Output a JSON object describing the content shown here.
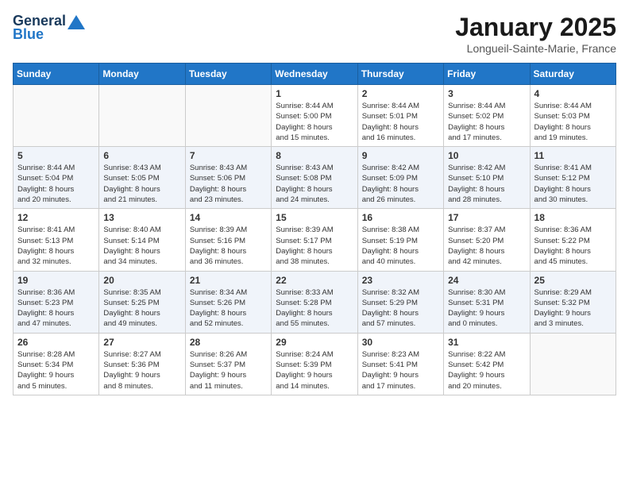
{
  "header": {
    "logo_general": "General",
    "logo_blue": "Blue",
    "month": "January 2025",
    "location": "Longueil-Sainte-Marie, France"
  },
  "days_of_week": [
    "Sunday",
    "Monday",
    "Tuesday",
    "Wednesday",
    "Thursday",
    "Friday",
    "Saturday"
  ],
  "weeks": [
    [
      {
        "day": "",
        "info": ""
      },
      {
        "day": "",
        "info": ""
      },
      {
        "day": "",
        "info": ""
      },
      {
        "day": "1",
        "info": "Sunrise: 8:44 AM\nSunset: 5:00 PM\nDaylight: 8 hours\nand 15 minutes."
      },
      {
        "day": "2",
        "info": "Sunrise: 8:44 AM\nSunset: 5:01 PM\nDaylight: 8 hours\nand 16 minutes."
      },
      {
        "day": "3",
        "info": "Sunrise: 8:44 AM\nSunset: 5:02 PM\nDaylight: 8 hours\nand 17 minutes."
      },
      {
        "day": "4",
        "info": "Sunrise: 8:44 AM\nSunset: 5:03 PM\nDaylight: 8 hours\nand 19 minutes."
      }
    ],
    [
      {
        "day": "5",
        "info": "Sunrise: 8:44 AM\nSunset: 5:04 PM\nDaylight: 8 hours\nand 20 minutes."
      },
      {
        "day": "6",
        "info": "Sunrise: 8:43 AM\nSunset: 5:05 PM\nDaylight: 8 hours\nand 21 minutes."
      },
      {
        "day": "7",
        "info": "Sunrise: 8:43 AM\nSunset: 5:06 PM\nDaylight: 8 hours\nand 23 minutes."
      },
      {
        "day": "8",
        "info": "Sunrise: 8:43 AM\nSunset: 5:08 PM\nDaylight: 8 hours\nand 24 minutes."
      },
      {
        "day": "9",
        "info": "Sunrise: 8:42 AM\nSunset: 5:09 PM\nDaylight: 8 hours\nand 26 minutes."
      },
      {
        "day": "10",
        "info": "Sunrise: 8:42 AM\nSunset: 5:10 PM\nDaylight: 8 hours\nand 28 minutes."
      },
      {
        "day": "11",
        "info": "Sunrise: 8:41 AM\nSunset: 5:12 PM\nDaylight: 8 hours\nand 30 minutes."
      }
    ],
    [
      {
        "day": "12",
        "info": "Sunrise: 8:41 AM\nSunset: 5:13 PM\nDaylight: 8 hours\nand 32 minutes."
      },
      {
        "day": "13",
        "info": "Sunrise: 8:40 AM\nSunset: 5:14 PM\nDaylight: 8 hours\nand 34 minutes."
      },
      {
        "day": "14",
        "info": "Sunrise: 8:39 AM\nSunset: 5:16 PM\nDaylight: 8 hours\nand 36 minutes."
      },
      {
        "day": "15",
        "info": "Sunrise: 8:39 AM\nSunset: 5:17 PM\nDaylight: 8 hours\nand 38 minutes."
      },
      {
        "day": "16",
        "info": "Sunrise: 8:38 AM\nSunset: 5:19 PM\nDaylight: 8 hours\nand 40 minutes."
      },
      {
        "day": "17",
        "info": "Sunrise: 8:37 AM\nSunset: 5:20 PM\nDaylight: 8 hours\nand 42 minutes."
      },
      {
        "day": "18",
        "info": "Sunrise: 8:36 AM\nSunset: 5:22 PM\nDaylight: 8 hours\nand 45 minutes."
      }
    ],
    [
      {
        "day": "19",
        "info": "Sunrise: 8:36 AM\nSunset: 5:23 PM\nDaylight: 8 hours\nand 47 minutes."
      },
      {
        "day": "20",
        "info": "Sunrise: 8:35 AM\nSunset: 5:25 PM\nDaylight: 8 hours\nand 49 minutes."
      },
      {
        "day": "21",
        "info": "Sunrise: 8:34 AM\nSunset: 5:26 PM\nDaylight: 8 hours\nand 52 minutes."
      },
      {
        "day": "22",
        "info": "Sunrise: 8:33 AM\nSunset: 5:28 PM\nDaylight: 8 hours\nand 55 minutes."
      },
      {
        "day": "23",
        "info": "Sunrise: 8:32 AM\nSunset: 5:29 PM\nDaylight: 8 hours\nand 57 minutes."
      },
      {
        "day": "24",
        "info": "Sunrise: 8:30 AM\nSunset: 5:31 PM\nDaylight: 9 hours\nand 0 minutes."
      },
      {
        "day": "25",
        "info": "Sunrise: 8:29 AM\nSunset: 5:32 PM\nDaylight: 9 hours\nand 3 minutes."
      }
    ],
    [
      {
        "day": "26",
        "info": "Sunrise: 8:28 AM\nSunset: 5:34 PM\nDaylight: 9 hours\nand 5 minutes."
      },
      {
        "day": "27",
        "info": "Sunrise: 8:27 AM\nSunset: 5:36 PM\nDaylight: 9 hours\nand 8 minutes."
      },
      {
        "day": "28",
        "info": "Sunrise: 8:26 AM\nSunset: 5:37 PM\nDaylight: 9 hours\nand 11 minutes."
      },
      {
        "day": "29",
        "info": "Sunrise: 8:24 AM\nSunset: 5:39 PM\nDaylight: 9 hours\nand 14 minutes."
      },
      {
        "day": "30",
        "info": "Sunrise: 8:23 AM\nSunset: 5:41 PM\nDaylight: 9 hours\nand 17 minutes."
      },
      {
        "day": "31",
        "info": "Sunrise: 8:22 AM\nSunset: 5:42 PM\nDaylight: 9 hours\nand 20 minutes."
      },
      {
        "day": "",
        "info": ""
      }
    ]
  ]
}
